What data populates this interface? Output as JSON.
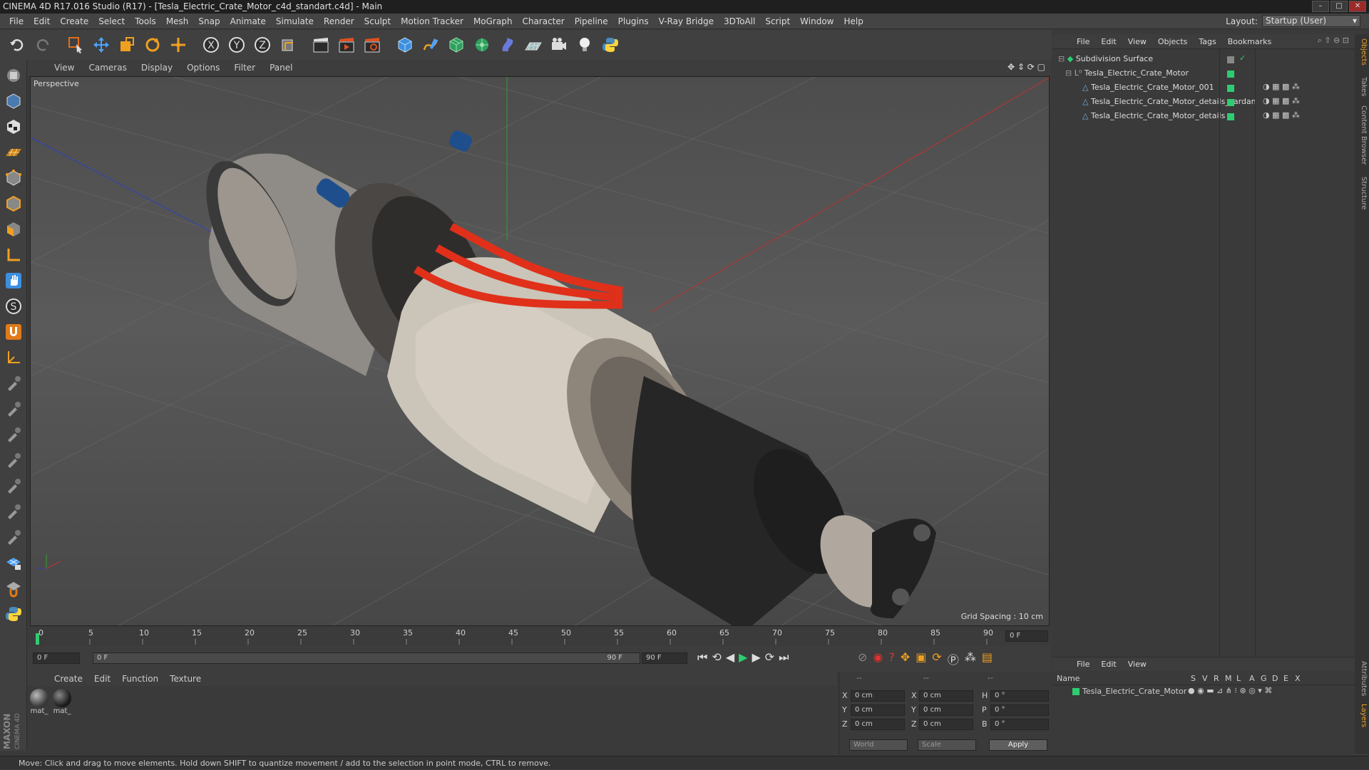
{
  "window": {
    "title": "CINEMA 4D R17.016 Studio (R17) - [Tesla_Electric_Crate_Motor_c4d_standart.c4d] - Main"
  },
  "menubar": {
    "items": [
      "File",
      "Edit",
      "Create",
      "Select",
      "Tools",
      "Mesh",
      "Snap",
      "Animate",
      "Simulate",
      "Render",
      "Sculpt",
      "Motion Tracker",
      "MoGraph",
      "Character",
      "Pipeline",
      "Plugins",
      "V-Ray Bridge",
      "3DToAll",
      "Script",
      "Window",
      "Help"
    ]
  },
  "layout": {
    "label": "Layout:",
    "value": "Startup (User)"
  },
  "viewport": {
    "menu": [
      "View",
      "Cameras",
      "Display",
      "Options",
      "Filter",
      "Panel"
    ],
    "label": "Perspective",
    "grid_spacing": "Grid Spacing : 10 cm"
  },
  "timeline": {
    "ticks": [
      "0",
      "5",
      "10",
      "15",
      "20",
      "25",
      "30",
      "35",
      "40",
      "45",
      "50",
      "55",
      "60",
      "65",
      "70",
      "75",
      "80",
      "85",
      "90"
    ],
    "current_frame": "0 F",
    "start_field": "0 F",
    "range_start": "0 F",
    "range_end": "90 F",
    "end_field": "90 F"
  },
  "material_panel": {
    "menu": [
      "Create",
      "Edit",
      "Function",
      "Texture"
    ],
    "materials": [
      "mat_",
      "mat_"
    ]
  },
  "coords_panel": {
    "headers": [
      "--",
      "--",
      "--"
    ],
    "rows": [
      {
        "a": "X",
        "av": "0 cm",
        "b": "X",
        "bv": "0 cm",
        "c": "H",
        "cv": "0 °"
      },
      {
        "a": "Y",
        "av": "0 cm",
        "b": "Y",
        "bv": "0 cm",
        "c": "P",
        "cv": "0 °"
      },
      {
        "a": "Z",
        "av": "0 cm",
        "b": "Z",
        "bv": "0 cm",
        "c": "B",
        "cv": "0 °"
      }
    ],
    "mode": "World",
    "size_mode": "Scale",
    "apply": "Apply"
  },
  "objects_panel": {
    "menu": [
      "File",
      "Edit",
      "View",
      "Objects",
      "Tags",
      "Bookmarks"
    ],
    "tree": [
      {
        "name": "Subdivision Surface",
        "level": 0
      },
      {
        "name": "Tesla_Electric_Crate_Motor",
        "level": 1
      },
      {
        "name": "Tesla_Electric_Crate_Motor_001",
        "level": 2
      },
      {
        "name": "Tesla_Electric_Crate_Motor_details_cardan",
        "level": 2
      },
      {
        "name": "Tesla_Electric_Crate_Motor_details",
        "level": 2
      }
    ]
  },
  "side_tabs": [
    "Objects",
    "Takes",
    "Content Browser",
    "Structure"
  ],
  "side_tabs_bottom": [
    "Attributes",
    "Layers"
  ],
  "attributes_panel": {
    "menu": [
      "File",
      "Edit",
      "View"
    ],
    "columns": [
      "Name",
      "S",
      "V",
      "R",
      "M",
      "L",
      "A",
      "G",
      "D",
      "E",
      "X"
    ],
    "row": "Tesla_Electric_Crate_Motor"
  },
  "status": "Move: Click and drag to move elements. Hold down SHIFT to quantize movement / add to the selection in point mode, CTRL to remove.",
  "colors": {
    "accent_green": "#2ecc71",
    "axis_x": "#c03030",
    "axis_y": "#30a030",
    "axis_z": "#3040c0",
    "cable_red": "#e0301a"
  }
}
